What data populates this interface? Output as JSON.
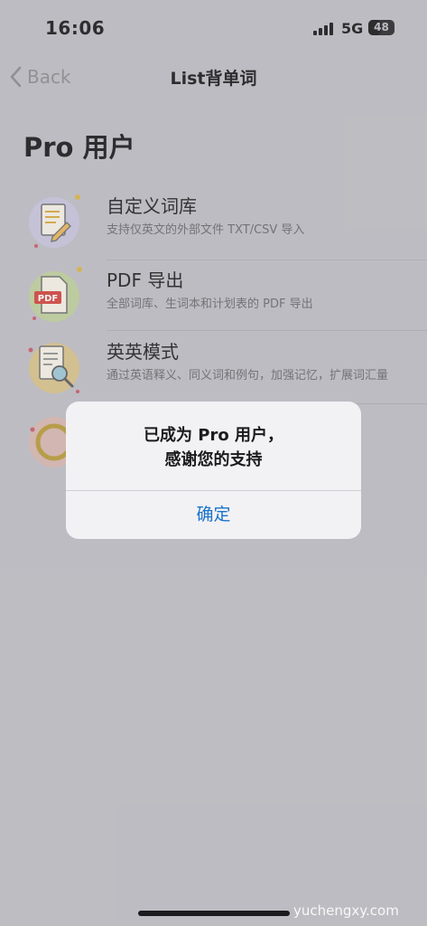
{
  "status": {
    "time": "16:06",
    "network": "5G",
    "battery": "48",
    "battery_level": 0.48
  },
  "nav": {
    "back_label": "Back",
    "title": "List背单词"
  },
  "section": {
    "title": "Pro 用户"
  },
  "features": [
    {
      "title": "自定义词库",
      "subtitle": "支持仅英文的外部文件 TXT/CSV 导入",
      "icon": "custom-dictionary-icon"
    },
    {
      "title": "PDF 导出",
      "subtitle": "全部词库、生词本和计划表的 PDF 导出",
      "icon": "pdf-export-icon"
    },
    {
      "title": "英英模式",
      "subtitle": "通过英语释义、同义词和例句，加强记忆，扩展词汇量",
      "icon": "english-mode-icon"
    },
    {
      "icon": "ring-icon"
    }
  ],
  "alert": {
    "line1": "已成为 Pro 用户，",
    "line2": "感谢您的支持",
    "confirm": "确定"
  },
  "watermark": "yuchengxy.com"
}
